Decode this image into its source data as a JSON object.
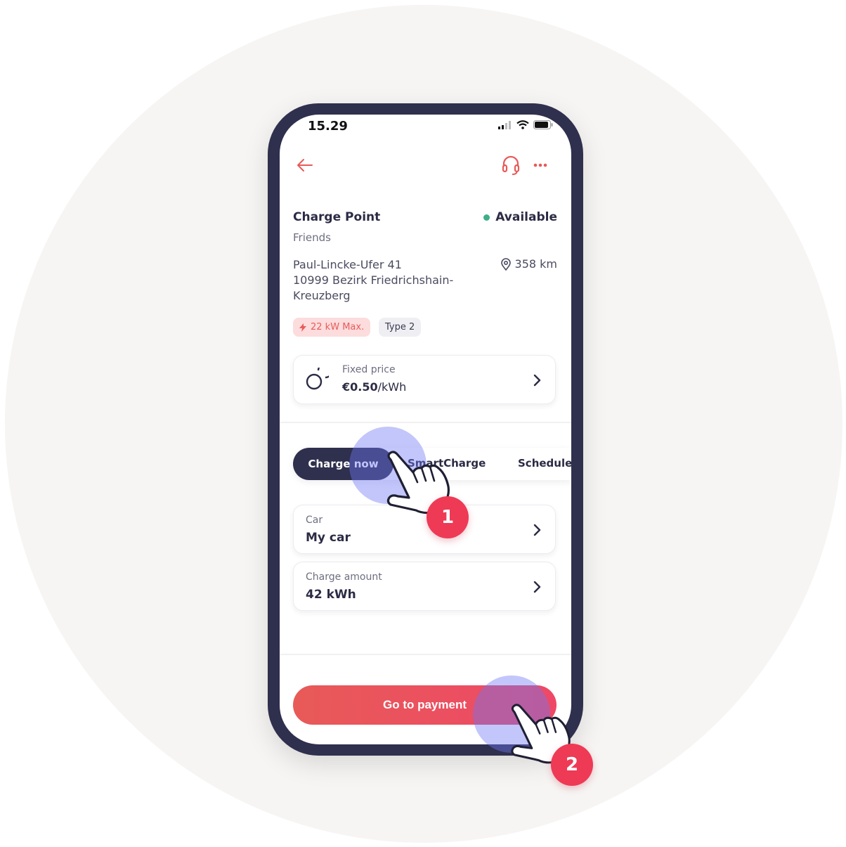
{
  "status_bar": {
    "time": "15.29"
  },
  "header": {
    "back_icon": "arrow-left-icon",
    "support_icon": "headset-icon",
    "more_icon": "more-dots-icon"
  },
  "charge_point": {
    "title": "Charge Point",
    "subtitle": "Friends",
    "status": "Available",
    "status_color": "#3fae86",
    "address_line1": "Paul-Lincke-Ufer 41",
    "address_line2": "10999 Bezirk Friedrichshain-Kreuzberg",
    "distance": "358 km",
    "chips": {
      "power": "22 kW Max.",
      "connector": "Type 2"
    }
  },
  "price": {
    "label": "Fixed price",
    "value": "€0.50",
    "unit": "/kWh"
  },
  "tabs": {
    "active": "Charge now",
    "smart": "SmartCharge",
    "schedule": "Schedule"
  },
  "fields": {
    "car": {
      "label": "Car",
      "value": "My car"
    },
    "amount": {
      "label": "Charge amount",
      "value": "42 kWh"
    }
  },
  "payment_button": {
    "label": "Go to payment"
  },
  "steps": {
    "step1": "1",
    "step2": "2"
  },
  "colors": {
    "accent": "#e85a58",
    "dark": "#2f2f4e",
    "badge": "#ee3a55"
  }
}
